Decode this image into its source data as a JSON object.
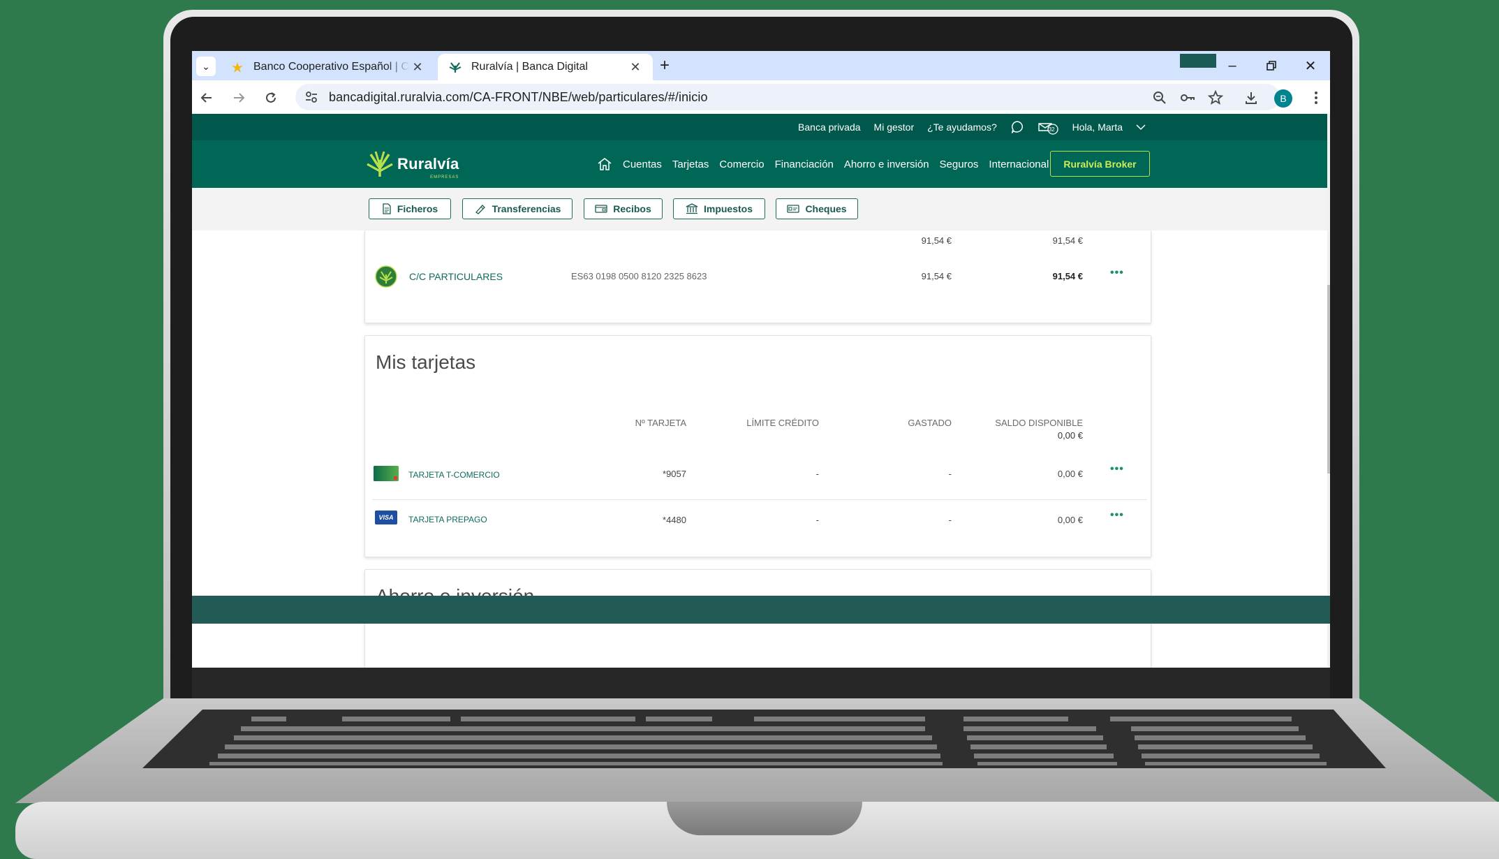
{
  "browser": {
    "tabs": [
      {
        "title": "Banco Cooperativo Español | Coo",
        "active": false
      },
      {
        "title": "Ruralvía | Banca Digital",
        "active": true
      }
    ],
    "url": "bancadigital.ruralvia.com/CA-FRONT/NBE/web/particulares/#/inicio",
    "profile_initial": "B"
  },
  "topbar": {
    "private_banking": "Banca privada",
    "my_manager": "Mi gestor",
    "help": "¿Te ayudamos?",
    "notifications_count": "32",
    "greeting": "Hola, Marta"
  },
  "brand": {
    "name": "Ruralvía",
    "sub": "EMPRESAS",
    "accent": "#b7e04d",
    "primary": "#006656"
  },
  "nav": {
    "items": [
      "Cuentas",
      "Tarjetas",
      "Comercio",
      "Financiación",
      "Ahorro e inversión",
      "Seguros",
      "Internacional"
    ],
    "broker": "Ruralvía Broker"
  },
  "quick_actions": [
    "Ficheros",
    "Transferencias",
    "Recibos",
    "Impuestos",
    "Cheques"
  ],
  "accounts": {
    "total_balance": "91,54 €",
    "total_available": "91,54 €",
    "rows": [
      {
        "name": "C/C PARTICULARES",
        "iban": "ES63 0198 0500 8120 2325 8623",
        "balance": "91,54 €",
        "available": "91,54 €",
        "more": "•••"
      }
    ]
  },
  "cards": {
    "title": "Mis tarjetas",
    "headers": {
      "number": "Nº TARJETA",
      "credit_limit": "LÍMITE CRÉDITO",
      "spent": "GASTADO",
      "available_balance": "SALDO DISPONIBLE"
    },
    "total_available": "0,00 €",
    "rows": [
      {
        "name": "TARJETA T-COMERCIO",
        "number": "*9057",
        "limit": "-",
        "spent": "-",
        "available": "0,00 €",
        "more": "•••"
      },
      {
        "name": "TARJETA PREPAGO",
        "number": "*4480",
        "limit": "-",
        "spent": "-",
        "available": "0,00 €",
        "more": "•••",
        "badge": "VISA"
      }
    ]
  },
  "savings": {
    "title": "Ahorro e inversión"
  }
}
